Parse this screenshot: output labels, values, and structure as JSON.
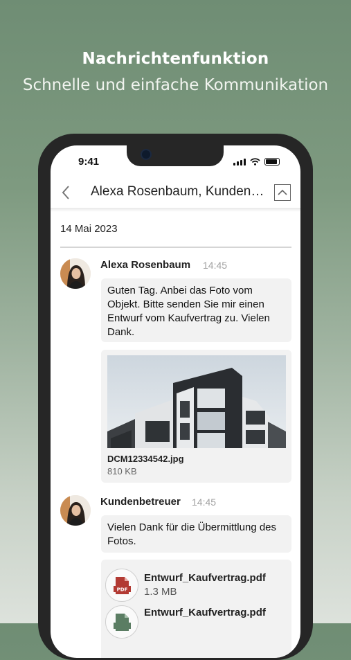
{
  "promo": {
    "title": "Nachrichtenfunktion",
    "subtitle": "Schnelle und einfache Kommunikation"
  },
  "status_bar": {
    "time": "9:41"
  },
  "header": {
    "title": "Alexa Rosenbaum, Kunden…"
  },
  "chat": {
    "date": "14 Mai 2023",
    "messages": [
      {
        "sender": "Alexa Rosenbaum",
        "time": "14:45",
        "text": "Guten Tag. Anbei das Foto vom Objekt. Bitte senden Sie mir einen Entwurf vom Kaufvertrag zu. Vielen Dank.",
        "attachment": {
          "name": "DCM12334542.jpg",
          "size": "810 KB"
        }
      },
      {
        "sender": "Kundenbetreuer",
        "time": "14:45",
        "text": "Vielen Dank für die Übermittlung des Fotos.",
        "files": [
          {
            "name": "Entwurf_Kaufvertrag.pdf",
            "size": "1.3 MB",
            "icon_label": "PDF"
          },
          {
            "name": "Entwurf_Kaufvertrag.pdf",
            "size": "",
            "icon_label": "PDF"
          }
        ]
      }
    ]
  },
  "colors": {
    "background": "#7e9a80",
    "pdf_red": "#b23a33",
    "pdf_green": "#5b7d63"
  }
}
